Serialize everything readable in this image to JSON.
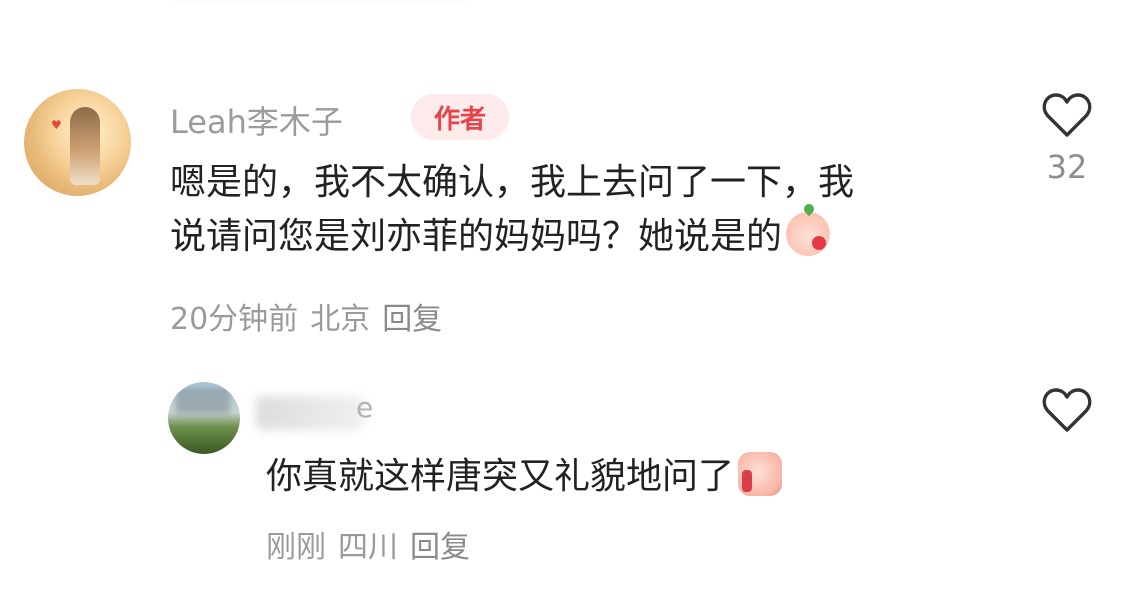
{
  "comment": {
    "username": "Leah李木子",
    "author_badge": "作者",
    "text_line1": "嗯是的，我不太确认，我上去问了一下，我",
    "text_line2": "说请问您是刘亦菲的妈妈吗？她说是的",
    "emoji": "blush-kiss-emoji",
    "time": "20分钟前",
    "location": "北京",
    "reply_label": "回复",
    "like_count": "32",
    "like_icon": "heart-outline-icon"
  },
  "reply": {
    "username_visible_tail": "e",
    "text": "你真就这样唐突又礼貌地问了",
    "emoji": "thumbs-up-emoji",
    "time": "刚刚",
    "location": "四川",
    "reply_label": "回复",
    "like_icon": "heart-outline-icon"
  },
  "colors": {
    "badge_bg": "#fdeaea",
    "badge_text": "#e8424b",
    "meta_text": "#9a9a9a",
    "body_text": "#222222"
  }
}
